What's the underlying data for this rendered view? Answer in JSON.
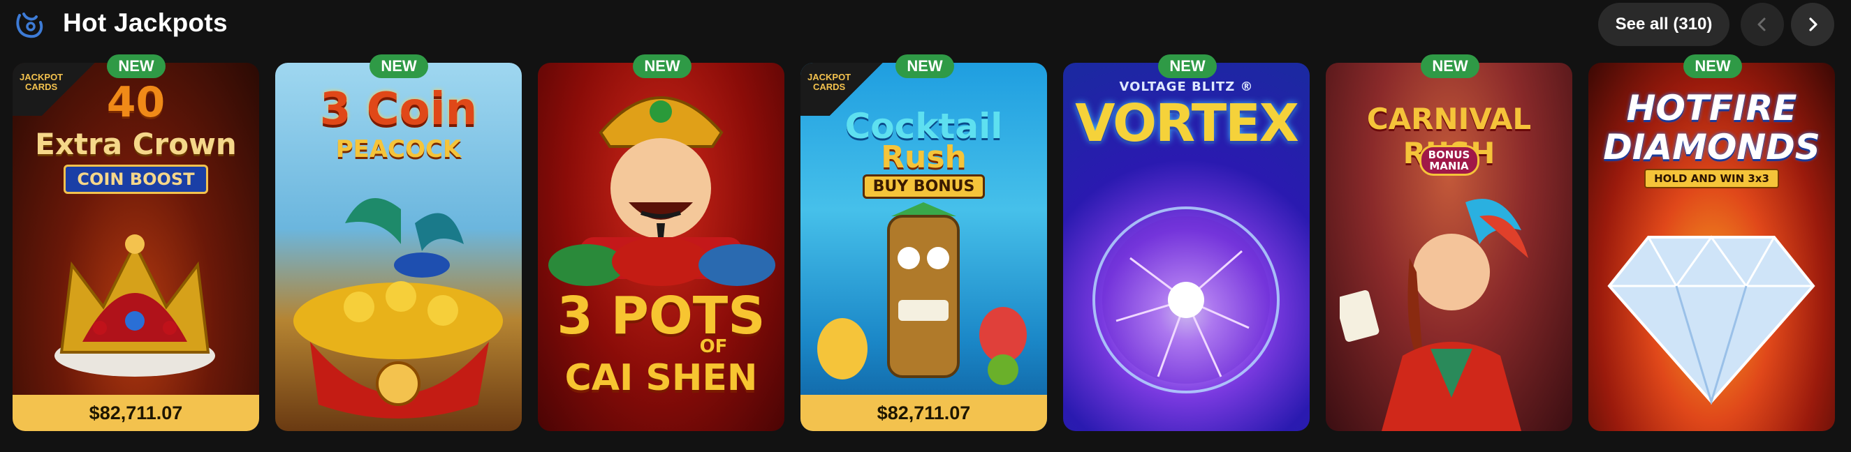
{
  "header": {
    "title": "Hot Jackpots",
    "see_all_label": "See all (310)"
  },
  "badge_label": "NEW",
  "games": [
    {
      "title_lines": [
        "40",
        "Extra Crown",
        "COIN BOOST"
      ],
      "badge": "NEW",
      "provider_tag": [
        "JACKPOT",
        "CARDS"
      ],
      "jackpot": "$82,711.07"
    },
    {
      "title_lines": [
        "3 Coin",
        "PEACOCK"
      ],
      "badge": "NEW"
    },
    {
      "title_lines": [
        "3 POTS",
        "OF",
        "CAI SHEN"
      ],
      "badge": "NEW"
    },
    {
      "title_lines": [
        "Cocktail",
        "Rush",
        "BUY BONUS"
      ],
      "badge": "NEW",
      "provider_tag": [
        "JACKPOT",
        "CARDS"
      ],
      "jackpot": "$82,711.07"
    },
    {
      "title_lines": [
        "VOLTAGE BLITZ ®",
        "VORTEX"
      ],
      "badge": "NEW"
    },
    {
      "title_lines": [
        "CARNIVAL RUSH",
        "BONUS MANIA"
      ],
      "badge": "NEW"
    },
    {
      "title_lines": [
        "HOTFIRE",
        "DIAMONDS",
        "HOLD AND WIN 3x3"
      ],
      "badge": "NEW"
    }
  ],
  "icons": {
    "logo": "brand-logo-icon",
    "prev": "chevron-left-icon",
    "next": "chevron-right-icon"
  },
  "colors": {
    "badge_green": "#2f9a46",
    "jackpot_gold": "#f3c24e",
    "background": "#121212"
  }
}
